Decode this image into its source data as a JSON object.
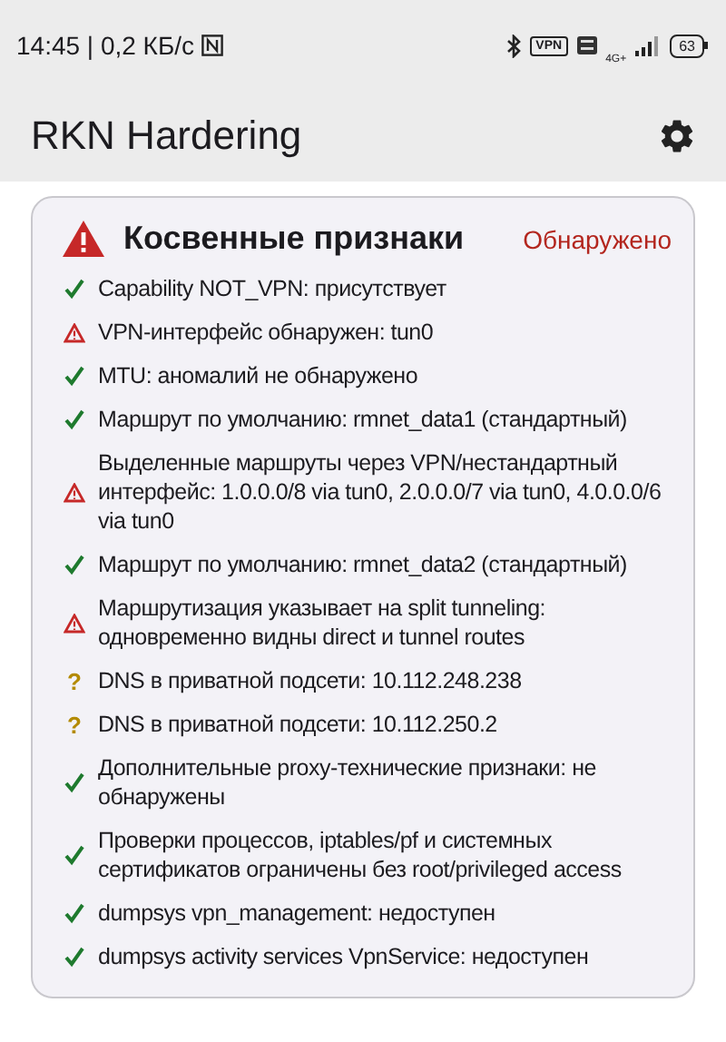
{
  "status_bar": {
    "time_speed": "14:45 | 0,2 КБ/с",
    "vpn_badge": "VPN",
    "network": "4G+",
    "battery": "63"
  },
  "app_bar": {
    "title": "RKN Hardering"
  },
  "card": {
    "title": "Косвенные признаки",
    "status": "Обнаружено",
    "items": [
      {
        "kind": "ok",
        "text": "Capability NOT_VPN: присутствует"
      },
      {
        "kind": "warn",
        "text": "VPN-интерфейс обнаружен: tun0"
      },
      {
        "kind": "ok",
        "text": "MTU: аномалий не обнаружено"
      },
      {
        "kind": "ok",
        "text": "Маршрут по умолчанию: rmnet_data1 (стандартный)"
      },
      {
        "kind": "warn",
        "text": "Выделенные маршруты через VPN/нестандартный интерфейс: 1.0.0.0/8 via tun0, 2.0.0.0/7 via tun0, 4.0.0.0/6 via tun0"
      },
      {
        "kind": "ok",
        "text": "Маршрут по умолчанию: rmnet_data2 (стандартный)"
      },
      {
        "kind": "warn",
        "text": "Маршрутизация указывает на split tunneling: одновременно видны direct и tunnel routes"
      },
      {
        "kind": "unknown",
        "glyph": "?",
        "text": "DNS в приватной подсети: 10.112.248.238"
      },
      {
        "kind": "unknown",
        "glyph": "?",
        "text": "DNS в приватной подсети: 10.112.250.2"
      },
      {
        "kind": "ok",
        "text": "Дополнительные proxy-технические признаки: не обнаружены"
      },
      {
        "kind": "ok",
        "text": "Проверки процессов, iptables/pf и системных сертификатов ограничены без root/privileged access"
      },
      {
        "kind": "ok",
        "text": "dumpsys vpn_management: недоступен"
      },
      {
        "kind": "ok",
        "text": "dumpsys activity services VpnService: недоступен"
      }
    ]
  }
}
